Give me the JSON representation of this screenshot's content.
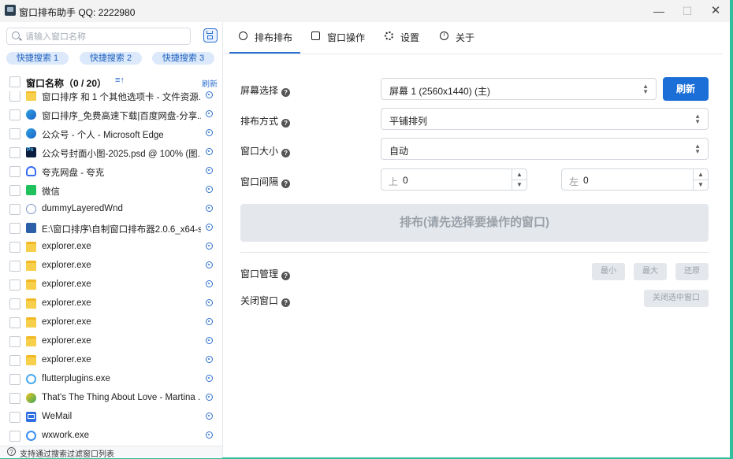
{
  "titlebar": {
    "title": "窗口排布助手 QQ: 2222980",
    "min": "—",
    "max": "☐",
    "close": "✕"
  },
  "search": {
    "placeholder": "请输入窗口名称"
  },
  "quick_search": [
    "快捷搜索 1",
    "快捷搜索 2",
    "快捷搜索 3"
  ],
  "list": {
    "header_title": "窗口名称（0 / 20）",
    "sort_symbol": "≡↑",
    "refresh": "刷新",
    "items": [
      {
        "label": "窗口排序 和 1 个其他选项卡 - 文件资源...",
        "icon": "folder-icon"
      },
      {
        "label": "窗口排序_免费高速下载|百度网盘-分享...",
        "icon": "edge-icon"
      },
      {
        "label": "公众号 - 个人 - Microsoft Edge",
        "icon": "edge-icon"
      },
      {
        "label": "公众号封面小图-2025.psd @ 100% (图...",
        "icon": "photoshop-icon"
      },
      {
        "label": "夸克网盘 - 夸克",
        "icon": "quark-cloud-icon"
      },
      {
        "label": "微信",
        "icon": "wechat-icon"
      },
      {
        "label": "dummyLayeredWnd",
        "icon": "layered-window-icon"
      },
      {
        "label": "E:\\窗口排序\\自制窗口排布器2.0.6_x64-s...",
        "icon": "installer-icon"
      },
      {
        "label": "explorer.exe",
        "icon": "folder-icon"
      },
      {
        "label": "explorer.exe",
        "icon": "folder-icon"
      },
      {
        "label": "explorer.exe",
        "icon": "folder-icon"
      },
      {
        "label": "explorer.exe",
        "icon": "folder-icon"
      },
      {
        "label": "explorer.exe",
        "icon": "folder-icon"
      },
      {
        "label": "explorer.exe",
        "icon": "folder-icon"
      },
      {
        "label": "explorer.exe",
        "icon": "folder-icon"
      },
      {
        "label": "flutterplugins.exe",
        "icon": "flutter-icon"
      },
      {
        "label": "That's The Thing About Love - Martina ...",
        "icon": "music-icon"
      },
      {
        "label": "WeMail",
        "icon": "mail-icon"
      },
      {
        "label": "wxwork.exe",
        "icon": "wxwork-icon"
      }
    ]
  },
  "footer_tip": "支持通过搜索过滤窗口列表",
  "footer_help_symbol": "?",
  "tabs": [
    "排布排布",
    "窗口操作",
    "设置",
    "关于"
  ],
  "form": {
    "screen_label": "屏幕选择",
    "screen_value": "屏幕 1 (2560x1440) (主)",
    "refresh_button": "刷新",
    "layout_label": "排布方式",
    "layout_value": "平铺排列",
    "size_label": "窗口大小",
    "size_value": "自动",
    "gap_label": "窗口间隔",
    "gap_top_prefix": "上",
    "gap_top_value": "0",
    "gap_left_prefix": "左",
    "gap_left_value": "0",
    "arrange_button": "排布(请先选择要操作的窗口)",
    "manage_label": "窗口管理",
    "min_button": "最小",
    "max_button": "最大",
    "restore_button": "还原",
    "close_label": "关闭窗口",
    "close_selected_button": "关闭选中窗口"
  },
  "help_symbol": "?",
  "colors": {
    "accent": "#1d6fd8",
    "desktop": "#2fbf9a",
    "disabled": "#e4e7eb"
  }
}
